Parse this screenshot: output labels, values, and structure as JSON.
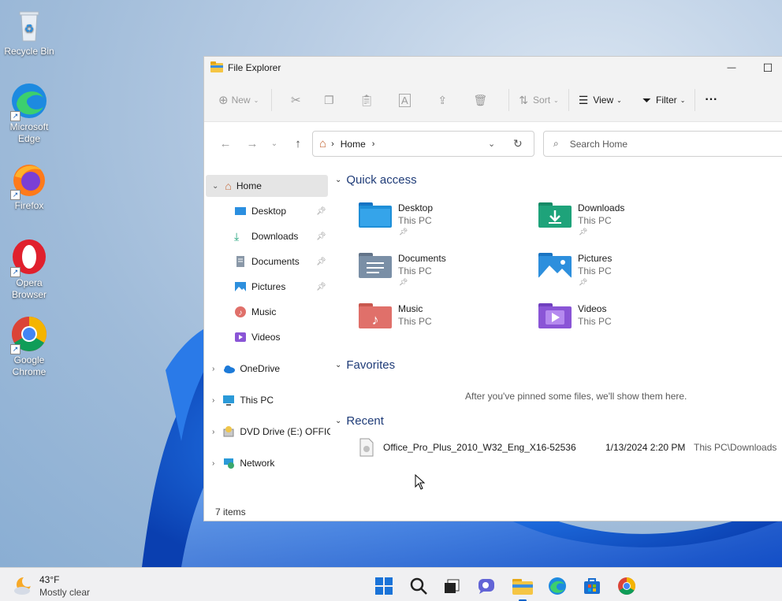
{
  "desktop": {
    "icons": [
      {
        "label": "Recycle Bin"
      },
      {
        "label": "Microsoft Edge"
      },
      {
        "label": "Firefox"
      },
      {
        "label": "Opera Browser"
      },
      {
        "label": "Google Chrome"
      }
    ]
  },
  "window": {
    "title": "File Explorer",
    "min_glyph": "—",
    "max_glyph": "☐"
  },
  "toolbar": {
    "new_label": "New",
    "sort_label": "Sort",
    "view_label": "View",
    "filter_label": "Filter",
    "more_glyph": "···"
  },
  "address": {
    "path": "Home",
    "search_placeholder": "Search Home"
  },
  "sidebar": {
    "home": "Home",
    "pinned": [
      {
        "label": "Desktop",
        "icon": "desktop-icon"
      },
      {
        "label": "Downloads",
        "icon": "downloads-icon"
      },
      {
        "label": "Documents",
        "icon": "documents-icon"
      },
      {
        "label": "Pictures",
        "icon": "pictures-icon"
      },
      {
        "label": "Music",
        "icon": "music-icon"
      },
      {
        "label": "Videos",
        "icon": "videos-icon"
      }
    ],
    "drives": [
      {
        "label": "OneDrive"
      },
      {
        "label": "This PC"
      },
      {
        "label": "DVD Drive (E:) OFFIC"
      },
      {
        "label": "Network"
      }
    ]
  },
  "quick_access": {
    "heading": "Quick access",
    "items": [
      {
        "name": "Desktop",
        "location": "This PC",
        "color": "#1e8fd8"
      },
      {
        "name": "Downloads",
        "location": "This PC",
        "color": "#1ea37a"
      },
      {
        "name": "Documents",
        "location": "This PC",
        "color": "#7a8fa6"
      },
      {
        "name": "Pictures",
        "location": "This PC",
        "color": "#2d8fdd"
      },
      {
        "name": "Music",
        "location": "This PC",
        "color": "#e0706a"
      },
      {
        "name": "Videos",
        "location": "This PC",
        "color": "#8a55d6"
      }
    ]
  },
  "favorites": {
    "heading": "Favorites",
    "empty_text": "After you've pinned some files, we'll show them here."
  },
  "recent": {
    "heading": "Recent",
    "files": [
      {
        "name": "Office_Pro_Plus_2010_W32_Eng_X16-52536",
        "date": "1/13/2024 2:20 PM",
        "location": "This PC\\Downloads"
      }
    ]
  },
  "status": {
    "items": "7 items"
  },
  "taskbar": {
    "weather_temp": "43°F",
    "weather_desc": "Mostly clear"
  }
}
